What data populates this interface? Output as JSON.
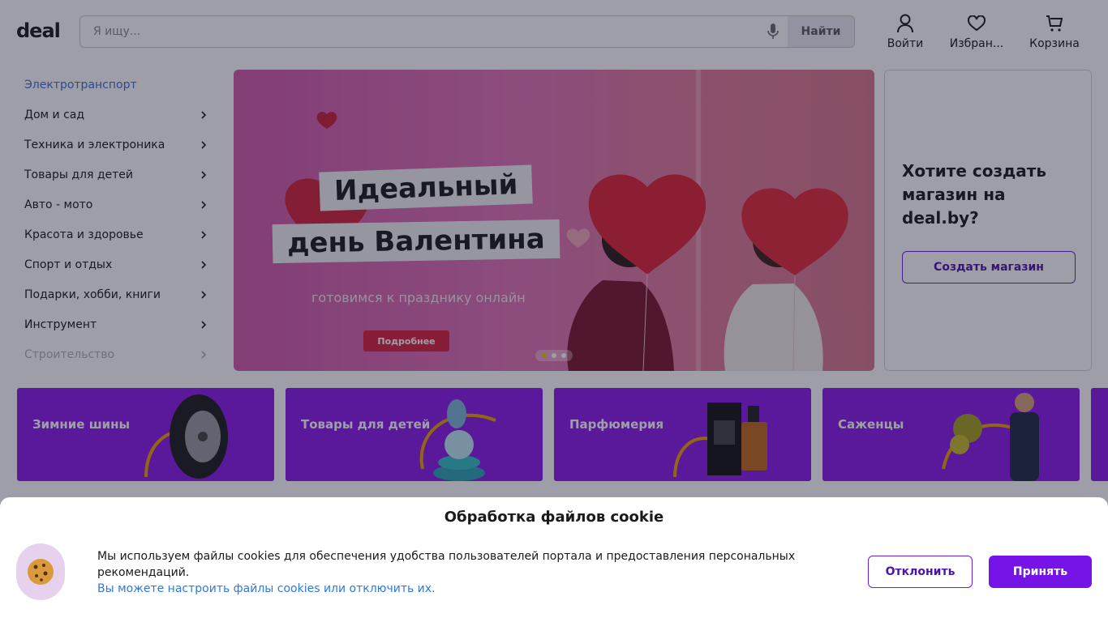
{
  "header": {
    "logo": "deal",
    "search_placeholder": "Я ищу...",
    "search_button": "Найти",
    "login": "Войти",
    "favorites": "Избран...",
    "cart": "Корзина"
  },
  "sidebar": {
    "items": [
      {
        "label": "Электротранспорт"
      },
      {
        "label": "Дом и сад"
      },
      {
        "label": "Техника и электроника"
      },
      {
        "label": "Товары для детей"
      },
      {
        "label": "Авто - мото"
      },
      {
        "label": "Красота и здоровье"
      },
      {
        "label": "Спорт и отдых"
      },
      {
        "label": "Подарки, хобби, книги"
      },
      {
        "label": "Инструмент"
      },
      {
        "label": "Строительство"
      }
    ]
  },
  "banner": {
    "title_line1": "Идеальный",
    "title_line2": "день Валентина",
    "subtitle": "готовимся к празднику онлайн",
    "button": "Подробнее",
    "slide_count": 3,
    "active_slide": 1
  },
  "promo": {
    "title": "Хотите создать магазин на deal.by?",
    "button": "Создать магазин"
  },
  "tiles": [
    {
      "label": "Зимние шины",
      "icon": "tire-icon"
    },
    {
      "label": "Товары для детей",
      "icon": "toy-icon"
    },
    {
      "label": "Парфюмерия",
      "icon": "perfume-icon"
    },
    {
      "label": "Саженцы",
      "icon": "seedling-icon"
    }
  ],
  "cookie": {
    "title": "Обработка файлов cookie",
    "text": "Мы используем файлы cookies для обеспечения удобства пользователей портала и предоставления персональных рекомендаций.",
    "link": "Вы можете настроить файлы cookies или отключить их.",
    "decline": "Отклонить",
    "accept": "Принять"
  },
  "colors": {
    "brand_purple": "#7614e8",
    "tile_purple": "#8a1be8",
    "link_blue": "#2f7ad8",
    "banner_red": "#d8213d"
  }
}
